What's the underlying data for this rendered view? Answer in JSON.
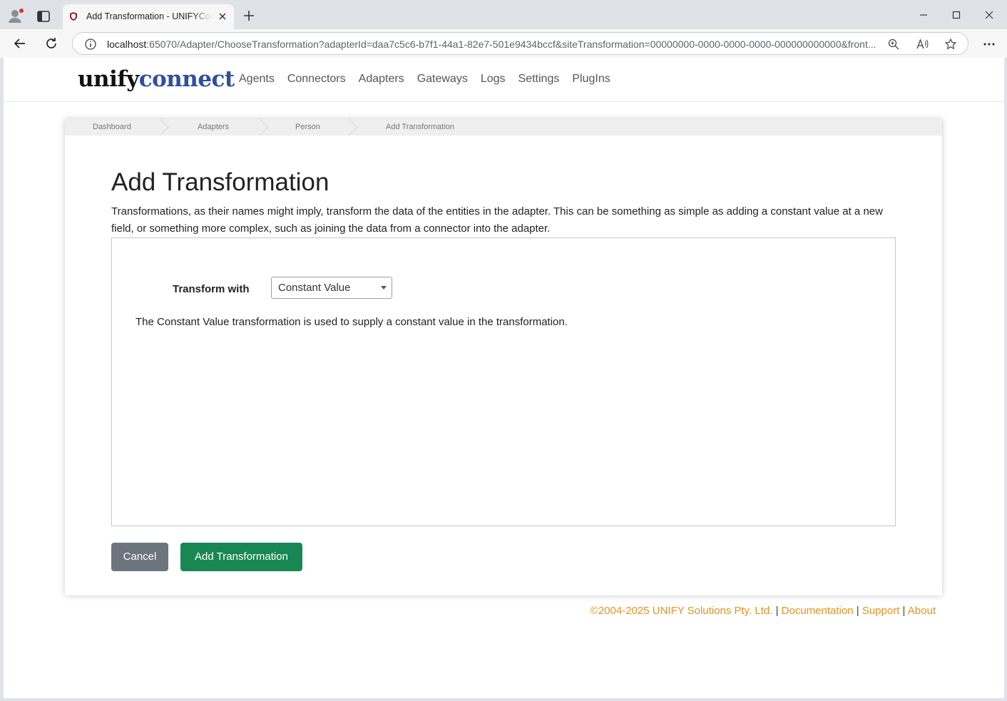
{
  "browser": {
    "tab_title": "Add Transformation - UNIFYConnect",
    "url_host": "localhost",
    "url_rest": ":65070/Adapter/ChooseTransformation?adapterId=daa7c5c6-b7f1-44a1-82e7-501e9434bccf&siteTransformation=00000000-0000-0000-0000-000000000000&front..."
  },
  "brand": {
    "part1": "unify",
    "part2": "connect"
  },
  "nav": {
    "items": [
      "Agents",
      "Connectors",
      "Adapters",
      "Gateways",
      "Logs",
      "Settings",
      "PlugIns"
    ]
  },
  "breadcrumb": [
    "Dashboard",
    "Adapters",
    "Person",
    "Add Transformation"
  ],
  "main": {
    "title": "Add Transformation",
    "intro": "Transformations, as their names might imply, transform the data of the entities in the adapter. This can be something as simple as adding a constant value at a new field, or something more complex, such as joining the data from a connector into the adapter.",
    "transform_label": "Transform with",
    "transform_value": "Constant Value",
    "description": "The Constant Value transformation is used to supply a constant value in the transformation."
  },
  "buttons": {
    "cancel": "Cancel",
    "add": "Add Transformation"
  },
  "footer": {
    "copyright": "©2004-2025 UNIFY Solutions Pty. Ltd.",
    "sep": "|",
    "links": [
      "Documentation",
      "Support",
      "About"
    ]
  },
  "colors": {
    "brand_blue": "#2f4f9f",
    "success": "#198754",
    "secondary": "#6c757d",
    "footer_link": "#e8911f"
  }
}
